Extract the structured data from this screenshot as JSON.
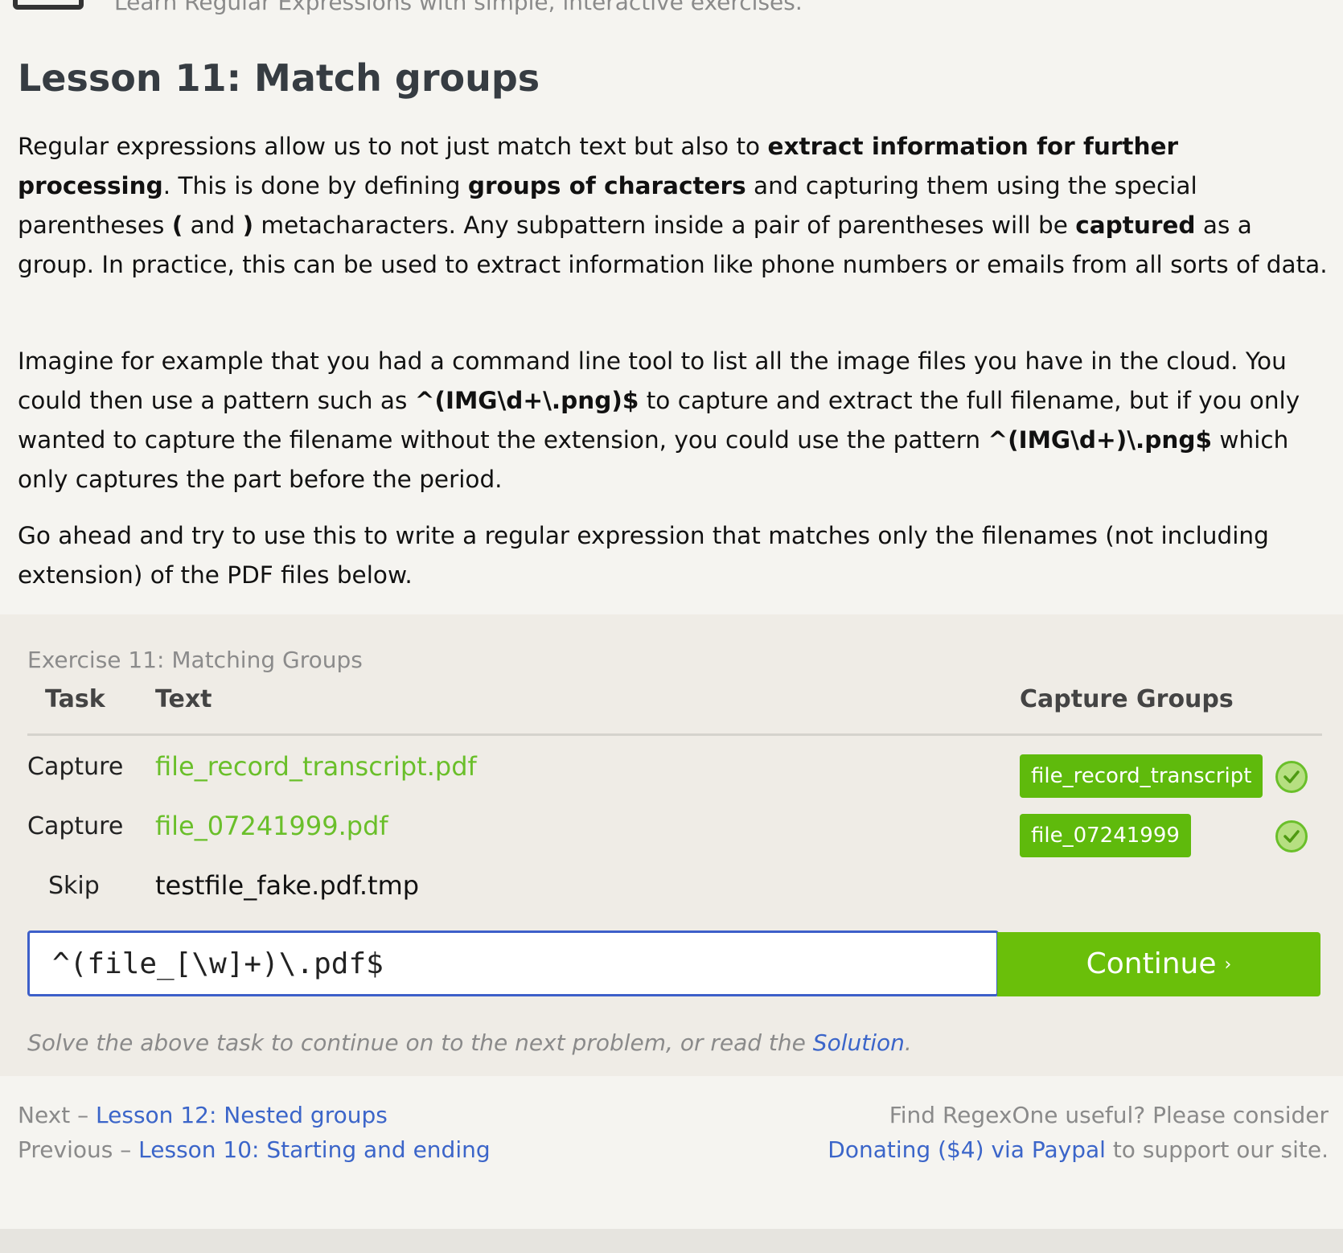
{
  "header": {
    "tagline": "Learn Regular Expressions with simple, interactive exercises."
  },
  "lesson": {
    "title": "Lesson 11: Match groups",
    "p1": [
      "Regular expressions allow us to not just match text but also to ",
      "extract information for further processing",
      ". This is done by defining ",
      "groups of characters",
      " and capturing them using the special parentheses ",
      "(",
      " and ",
      ")",
      " metacharacters. Any subpattern inside a pair of parentheses will be ",
      "captured",
      " as a group. In practice, this can be used to extract information like phone numbers or emails from all sorts of data."
    ],
    "p2": [
      "Imagine for example that you had a command line tool to list all the image files you have in the cloud. You could then use a pattern such as ",
      "^(IMG\\d+\\.png)$",
      " to capture and extract the full filename, but if you only wanted to capture the filename without the extension, you could use the pattern ",
      "^(IMG\\d+)\\.png$",
      " which only captures the part before the period."
    ],
    "p3": "Go ahead and try to use this to write a regular expression that matches only the filenames (not including extension) of the PDF files below."
  },
  "exercise": {
    "title": "Exercise 11: Matching Groups",
    "headers": {
      "task": "Task",
      "text": "Text",
      "capture_groups": "Capture Groups"
    },
    "rows": [
      {
        "task": "Capture",
        "text": "file_record_transcript.pdf",
        "group": "file_record_transcript",
        "status": "matched"
      },
      {
        "task": "Capture",
        "text": "file_07241999.pdf",
        "group": "file_07241999",
        "status": "matched"
      },
      {
        "task": "Skip",
        "text": "testfile_fake.pdf.tmp"
      }
    ],
    "input_value": "^(file_[\\w]+)\\.pdf$",
    "continue_label": "Continue",
    "continue_chevron": "›",
    "hint_prefix": "Solve the above task to continue on to the next problem, or read the ",
    "hint_link": "Solution",
    "hint_suffix": "."
  },
  "footer": {
    "next_label": "Next – ",
    "next_link": "Lesson 12: Nested groups",
    "prev_label": "Previous – ",
    "prev_link": "Lesson 10: Starting and ending",
    "donate_line1": "Find RegexOne useful? Please consider",
    "donate_link": "Donating ($4) via Paypal",
    "donate_suffix": " to support our site."
  },
  "colors": {
    "accent_green": "#6abf0a",
    "link_blue": "#3b65c9",
    "page_bg": "#f5f4f0",
    "exercise_bg": "#efece6"
  }
}
